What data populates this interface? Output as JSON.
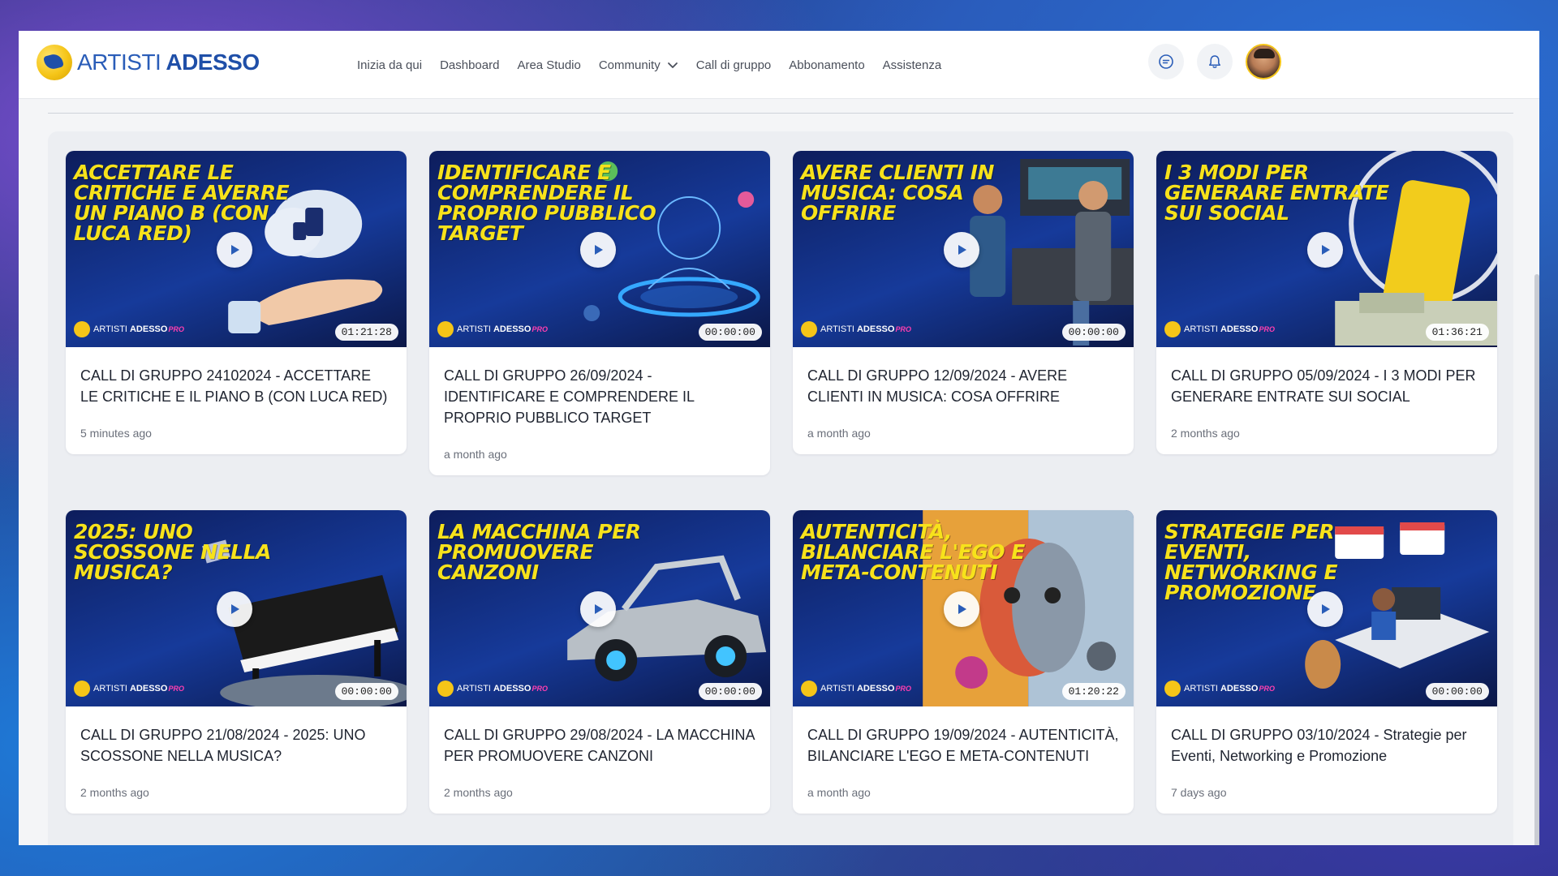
{
  "app": {
    "logo_part1": "ARTISTI",
    "logo_part2": "ADESSO",
    "brand_color": "#2a5db8",
    "accent_color": "#f5c518"
  },
  "nav": {
    "items": [
      {
        "label": "Inizia da qui"
      },
      {
        "label": "Dashboard"
      },
      {
        "label": "Area Studio"
      },
      {
        "label": "Community",
        "dropdown": true
      },
      {
        "label": "Call di gruppo"
      },
      {
        "label": "Abbonamento"
      },
      {
        "label": "Assistenza"
      }
    ]
  },
  "header_icons": [
    "chat-icon",
    "bell-icon"
  ],
  "thumb_brand": {
    "part1": "ARTISTI",
    "part2": "ADESSO",
    "suffix": "PRO"
  },
  "videos": [
    {
      "thumb_text": "ACCETTARE LE CRITICHE E AVERRE UN PIANO B (CON LUCA RED)",
      "duration": "01:21:28",
      "title": "CALL DI GRUPPO 24102024 - ACCETTARE LE CRITICHE E IL PIANO B (CON LUCA RED)",
      "time": "5 minutes ago",
      "art": "thumbs-up-hand"
    },
    {
      "thumb_text": "IDENTIFICARE E COMPRENDERE IL PROPRIO PUBBLICO TARGET",
      "duration": "00:00:00",
      "title": "CALL DI GRUPPO 26/09/2024 - IDENTIFICARE E COMPRENDERE IL PROPRIO PUBBLICO TARGET",
      "time": "a month ago",
      "art": "digital-head"
    },
    {
      "thumb_text": "AVERE CLIENTI IN MUSICA: COSA OFFRIRE",
      "duration": "00:00:00",
      "title": "CALL DI GRUPPO 12/09/2024 - AVERE CLIENTI IN MUSICA: COSA OFFRIRE",
      "time": "a month ago",
      "art": "studio-handshake"
    },
    {
      "thumb_text": "I 3 MODI PER GENERARE ENTRATE SUI SOCIAL",
      "duration": "01:36:21",
      "title": "CALL DI GRUPPO 05/09/2024 - I 3 MODI PER GENERARE ENTRATE SUI SOCIAL",
      "time": "2 months ago",
      "art": "phone-money"
    },
    {
      "thumb_text": "2025: UNO SCOSSONE NELLA MUSICA?",
      "duration": "00:00:00",
      "title": "CALL DI GRUPPO 21/08/2024 - 2025: UNO SCOSSONE NELLA MUSICA?",
      "time": "2 months ago",
      "art": "piano"
    },
    {
      "thumb_text": "LA MACCHINA PER PROMUOVERE CANZONI",
      "duration": "00:00:00",
      "title": "CALL DI GRUPPO 29/08/2024 - LA MACCHINA PER PROMUOVERE CANZONI",
      "time": "2 months ago",
      "art": "car"
    },
    {
      "thumb_text": "AUTENTICITÀ, BILANCIARE L'EGO E META-CONTENUTI",
      "duration": "01:20:22",
      "title": "CALL DI GRUPPO 19/09/2024 - AUTENTICITÀ, BILANCIARE L'EGO E META-CONTENUTI",
      "time": "a month ago",
      "art": "colorful-face"
    },
    {
      "thumb_text": "STRATEGIE PER EVENTI, NETWORKING E PROMOZIONE",
      "duration": "00:00:00",
      "title": "CALL DI GRUPPO 03/10/2024 - Strategie per Eventi, Networking e Promozione",
      "time": "7 days ago",
      "art": "event-desk"
    }
  ]
}
